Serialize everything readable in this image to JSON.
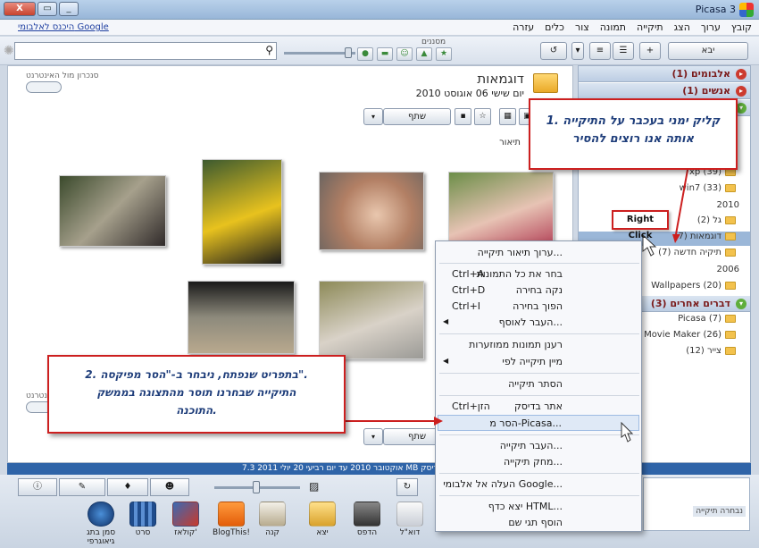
{
  "window": {
    "title": "Picasa 3",
    "close_label": "X"
  },
  "menu": [
    "קובץ",
    "ערוך",
    "הצג",
    "תיקייה",
    "תמונה",
    "צור",
    "כלים",
    "עזרה"
  ],
  "google_link": "היכנס לאלבומי Google",
  "toolbar": {
    "import_label": "יבא",
    "filters_label": "מסננים"
  },
  "sections": {
    "albums": "אלבומים (1)",
    "people": "אנשים (1)",
    "other": "דברים אחרים (3)"
  },
  "tree": {
    "xp": "xp (39)",
    "win7": "win7 (33)",
    "y2010": "2010",
    "gal": "גל (2)",
    "examples": "דוגמאות (7)",
    "new_folder": "תיקיה חדשה (7)",
    "y2006": "2006",
    "wallpapers": "Wallpapers (20)",
    "picasa": "Picasa (7)",
    "movie_maker": "Movie Maker (26)",
    "paint": "צייר (12)"
  },
  "center": {
    "folder_title": "דוגמאות",
    "folder_date": "יום שישי 06 אוגוסט 2010",
    "sync_label": "סנכרון מול האינטרנט",
    "share_label": "שתף",
    "desc_label": "תיאור"
  },
  "context_menu": [
    {
      "label": "ערוך תיאור תיקייה...",
      "shortcut": ""
    },
    {
      "label": "בחר את כל התמונות",
      "shortcut": "Ctrl+A"
    },
    {
      "label": "נקה בחירה",
      "shortcut": "Ctrl+D"
    },
    {
      "label": "הפוך בחירה",
      "shortcut": "Ctrl+I"
    },
    {
      "label": "העבר לאוסף...",
      "shortcut": ""
    },
    {
      "label": "רענן תמונות ממוזערות",
      "shortcut": ""
    },
    {
      "label": "מיין תיקייה לפי",
      "shortcut": ""
    },
    {
      "label": "הסתר תיקייה",
      "shortcut": ""
    },
    {
      "label": "אתר בדיסק",
      "shortcut": "Ctrl+הזן"
    },
    {
      "label": "הסר מ-Picasa...",
      "shortcut": ""
    },
    {
      "label": "העבר תיקייה...",
      "shortcut": ""
    },
    {
      "label": "מחק תיקייה...",
      "shortcut": ""
    },
    {
      "label": "העלה אל אלבומי Google...",
      "shortcut": ""
    },
    {
      "label": "יצא כדף HTML...",
      "shortcut": ""
    },
    {
      "label": "הוסף תגי שם",
      "shortcut": ""
    }
  ],
  "callouts": {
    "first_line1": "1. קליק ימני בעכבר על התיקייה",
    "first_line2": "אותה אנו רוצים להסיר",
    "second_line1": "2. בתפריט שנפתח, ניבחר ב-\"הסר מפיקסה\".",
    "second_line2": "התיקייה שבחרנו תוסר מהתצוגה בממשק",
    "second_line3": "התוכנה.",
    "right_click": "Right Click"
  },
  "status": {
    "text": "אוקטובר 2010 עד יום רביעי 20 יולי 2011   7.3 MB בדיסק"
  },
  "actions": [
    "דוא\"ל",
    "הדפס",
    "יצא",
    "קנה",
    "BlogThis!",
    "קולאז'",
    "סרט",
    "סמן בתג גיאוגרפי"
  ],
  "selection_label": "נבחרה תיקייה",
  "colors": {
    "accent_red": "#cc1f1f",
    "callout_text": "#1e3d7a",
    "status_bar": "#2f64a8"
  }
}
